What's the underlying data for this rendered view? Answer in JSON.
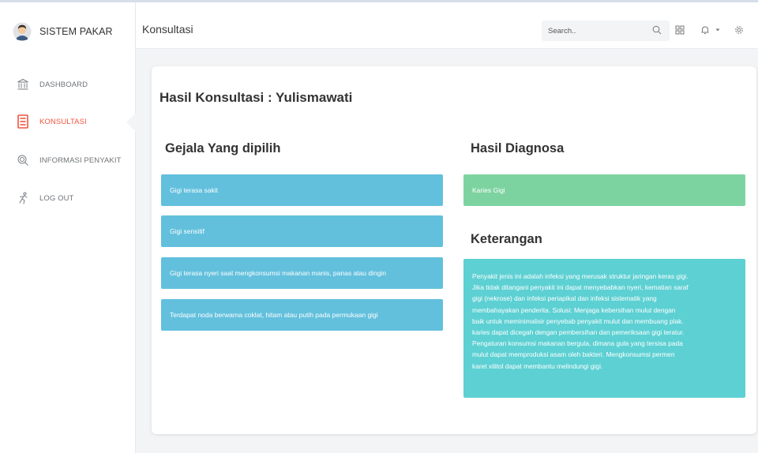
{
  "brand": {
    "name": "SISTEM PAKAR"
  },
  "sidebar": {
    "items": [
      {
        "label": "DASHBOARD",
        "icon": "bank-icon",
        "active": false
      },
      {
        "label": "KONSULTASI",
        "icon": "book-icon",
        "active": true
      },
      {
        "label": "INFORMASI PENYAKIT",
        "icon": "search-icon",
        "active": false
      },
      {
        "label": "LOG OUT",
        "icon": "running-man-icon",
        "active": false
      }
    ]
  },
  "header": {
    "title": "Konsultasi",
    "search_placeholder": "Search..",
    "icons": [
      "search-icon",
      "grid-icon",
      "bell-icon",
      "caret-down-icon",
      "gear-icon"
    ]
  },
  "main": {
    "title": "Hasil Konsultasi : Yulismawati",
    "gejala": {
      "title": "Gejala Yang dipilih",
      "items": [
        "Gigi terasa sakit",
        "Gigi sensitif",
        "Gigi terasa nyeri saat mengkonsumsi makanan manis, panas atau dingin",
        "Terdapat noda berwarna coklat, hitam atau putih pada permukaan gigi"
      ]
    },
    "diagnosa": {
      "title": "Hasil Diagnosa",
      "result": "Karies Gigi"
    },
    "keterangan": {
      "title": "Keterangan",
      "lines": [
        "Penyakit jenis ini adalah infeksi yang merusak struktur jaringan keras gigi.",
        "Jika tidak ditangani penyakit ini dapat menyebabkan nyeri, kematian saraf",
        "gigi (nekrose) dan infeksi periapikal dan infeksi sistematik yang",
        "membahayakan penderita. Solusi: Menjaga kebersihan mulut dengan",
        "baik untuk meminimalisir penyebab penyakit mulut dan membuang plak.",
        "karies dapat dicegah dengan pembersihan dan pemeriksaan gigi teratur.",
        "Pengaturan konsumsi makanan bergula, dimana gula yang tersisa pada",
        "mulut dapat memproduksi asam oleh bakteri. Mengkonsumsi permen",
        "karet xilitol dapat membantu melindungi gigi."
      ]
    }
  },
  "colors": {
    "accent": "#f0553d",
    "tile_blue": "#62c0dd",
    "tile_green": "#7dd3a0",
    "tile_teal": "#5dd0d3"
  }
}
